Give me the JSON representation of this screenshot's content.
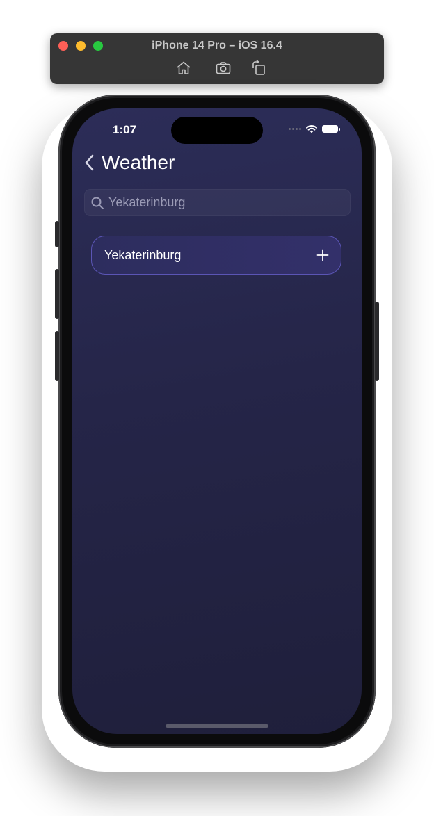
{
  "simulator": {
    "title": "iPhone 14 Pro – iOS 16.4",
    "tools": [
      "home-icon",
      "screenshot-icon",
      "rotate-icon"
    ]
  },
  "status_bar": {
    "time": "1:07"
  },
  "nav": {
    "title": "Weather"
  },
  "search": {
    "value": "Yekaterinburg"
  },
  "results": [
    {
      "label": "Yekaterinburg",
      "action_icon": "plus-icon"
    }
  ],
  "colors": {
    "background_top": "#2c2d58",
    "background_bottom": "#1f1f3b",
    "result_border": "#5b55b5",
    "result_fill": "#2d2d5e"
  }
}
